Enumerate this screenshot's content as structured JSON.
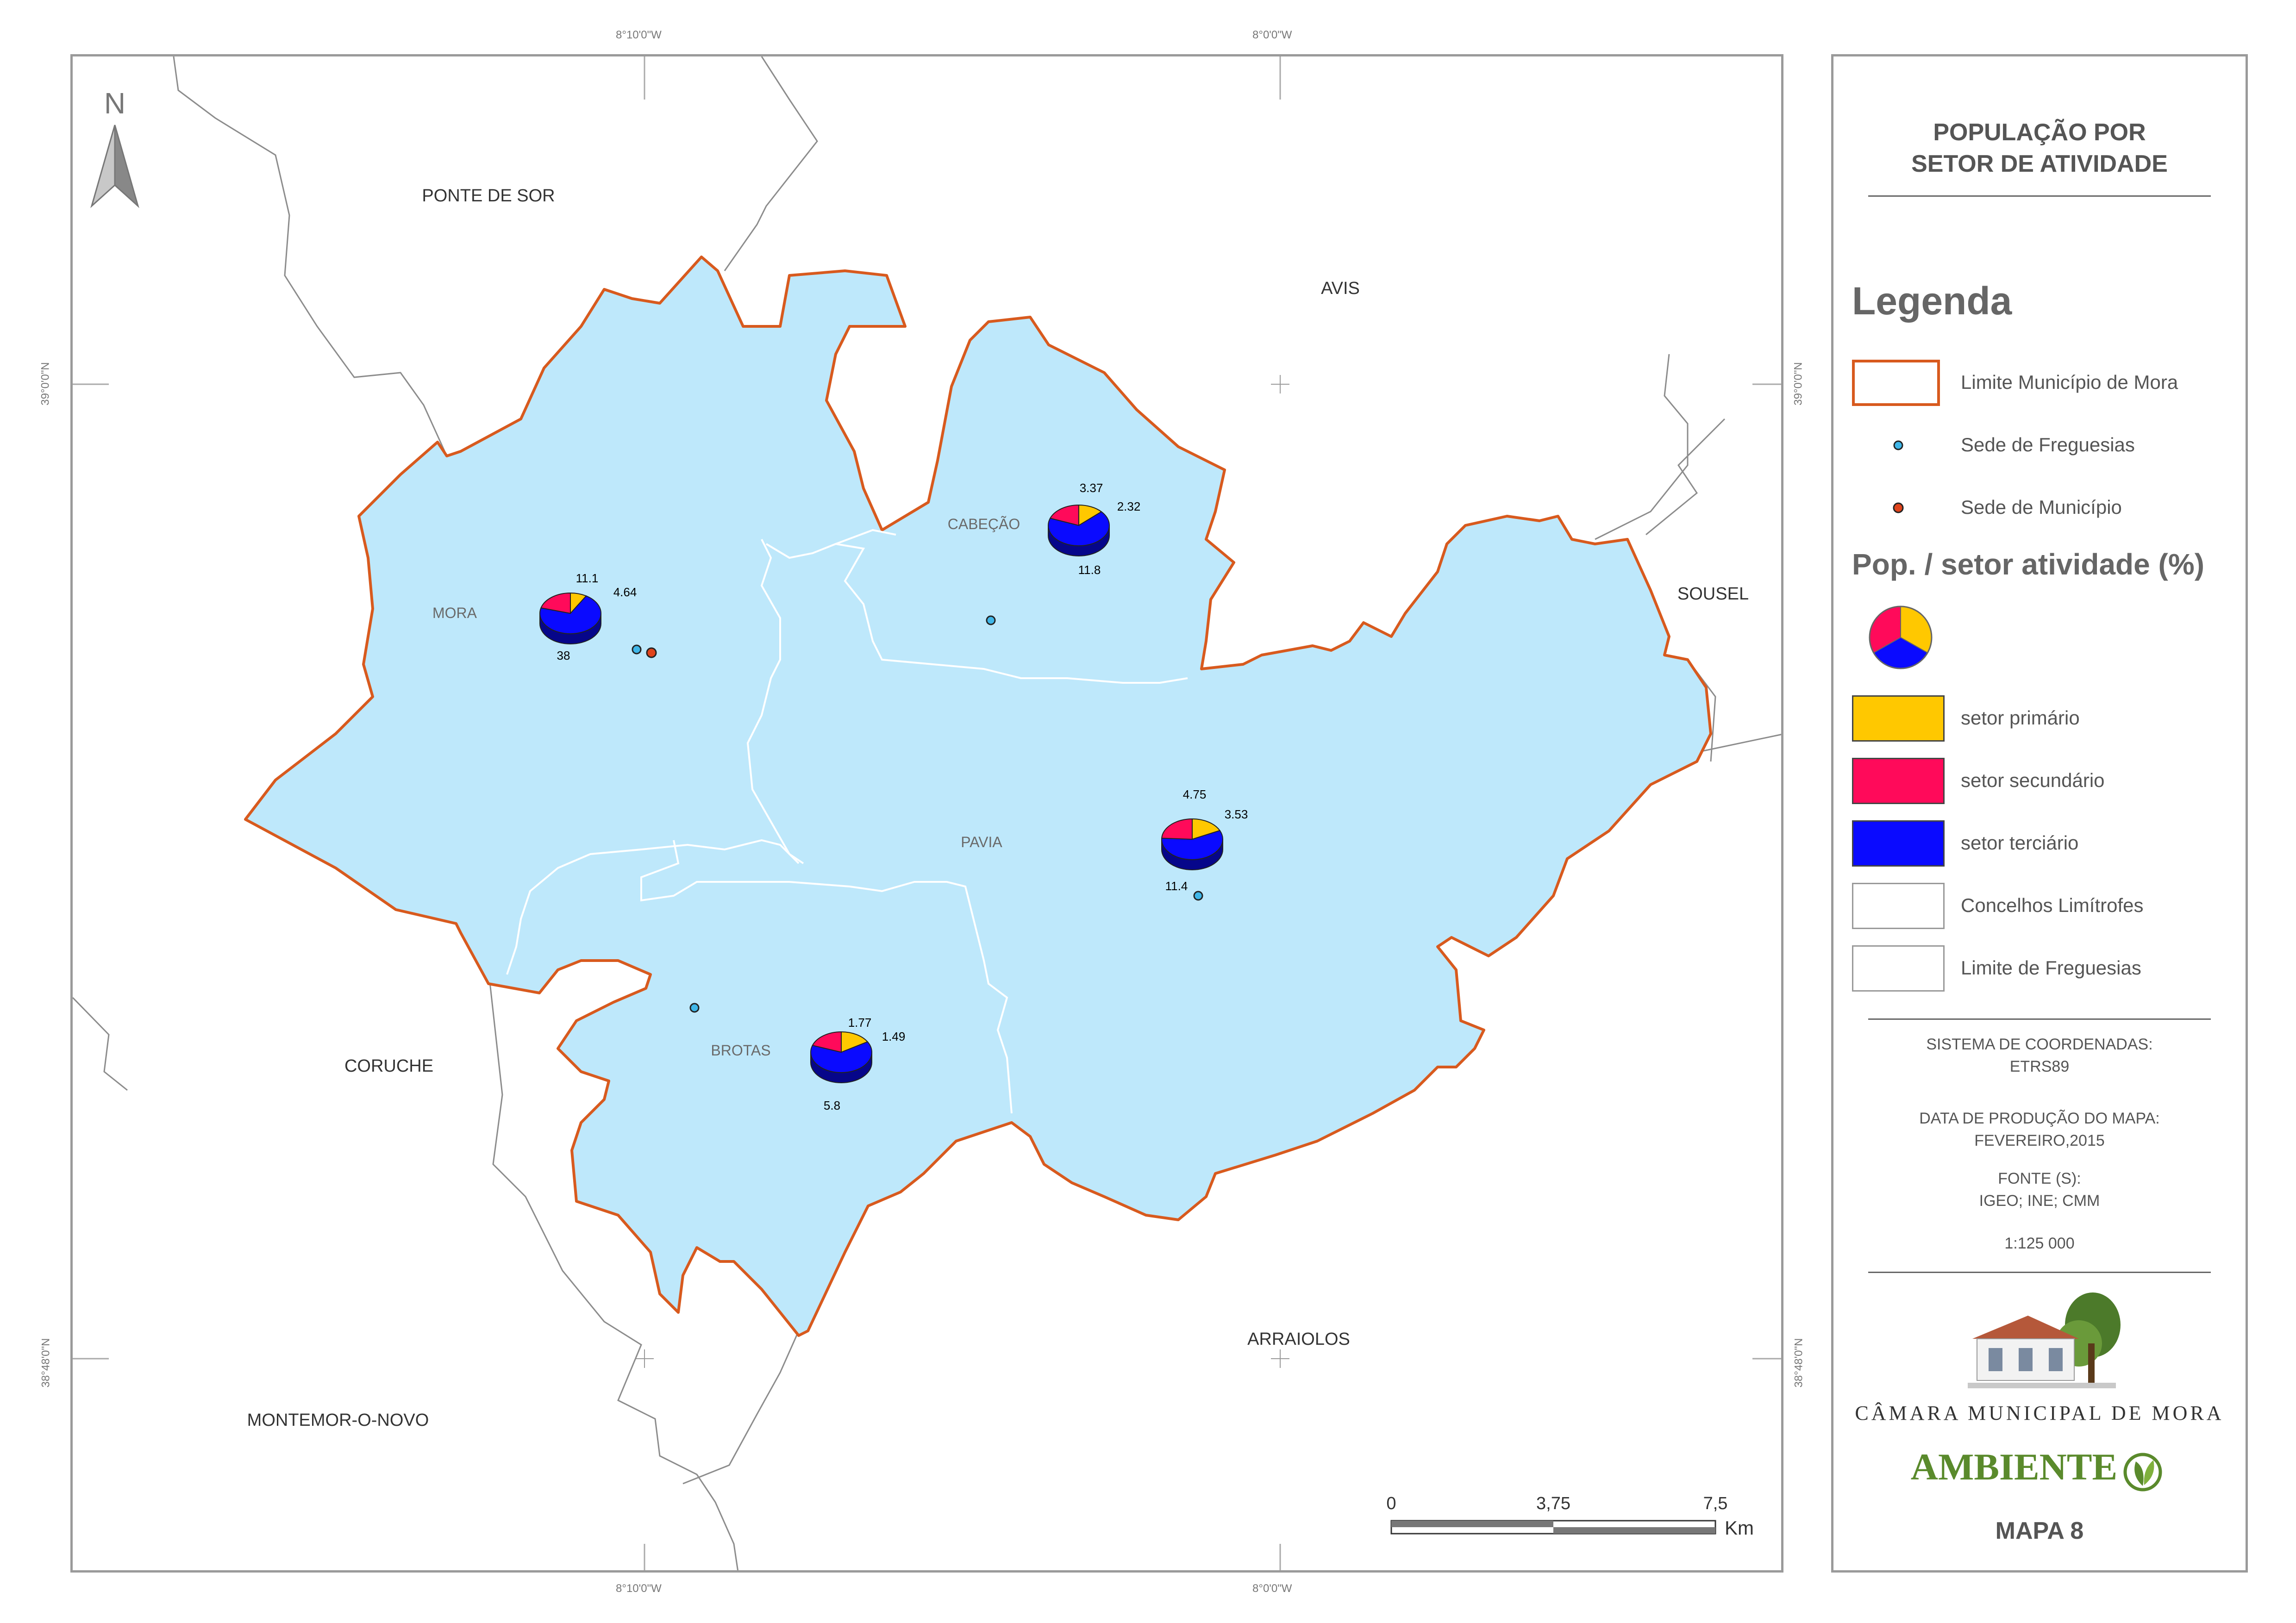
{
  "graticule": {
    "top": [
      "8°10'0\"W",
      "8°0'0\"W"
    ],
    "bottom": [
      "8°10'0\"W",
      "8°0'0\"W"
    ],
    "left": [
      "39°0'0\"N",
      "38°48'0\"N"
    ],
    "right": [
      "39°0'0\"N",
      "38°48'0\"N"
    ]
  },
  "north_arrow": {
    "label": "N"
  },
  "neighbors": [
    "PONTE DE SOR",
    "AVIS",
    "SOUSEL",
    "CORUCHE",
    "ARRAIOLOS",
    "MONTEMOR-O-NOVO"
  ],
  "parishes": [
    "MORA",
    "CABEÇÃO",
    "PAVIA",
    "BROTAS"
  ],
  "pie_charts": [
    {
      "parish": "MORA",
      "primario": 4.64,
      "secundario": 11.1,
      "terciario": 38
    },
    {
      "parish": "CABEÇÃO",
      "primario": 2.32,
      "secundario": 3.37,
      "terciario": 11.8
    },
    {
      "parish": "PAVIA",
      "primario": 3.53,
      "secundario": 4.75,
      "terciario": 11.4
    },
    {
      "parish": "BROTAS",
      "primario": 1.49,
      "secundario": 1.77,
      "terciario": 5.8
    }
  ],
  "scale_bar": {
    "ticks": [
      "0",
      "3,75",
      "7,5"
    ],
    "unit": "Km"
  },
  "colors": {
    "municipality_fill": "#bee8fb",
    "municipality_border": "#d85a1e",
    "parish_border": "#ffffff",
    "neighbor_border": "#8c8c8c",
    "primario": "#ffc800",
    "secundario": "#ff0a5a",
    "terciario": "#0a0aff",
    "sede_freguesia": "#3fb6e8",
    "sede_municipio": "#e0441c"
  },
  "legend_panel": {
    "title_line1": "POPULAÇÃO POR",
    "title_line2": "SETOR DE ATIVIDADE",
    "legend_heading": "Legenda",
    "items": {
      "limite_municipio": "Limite Município de Mora",
      "sede_freguesias": "Sede de Freguesias",
      "sede_municipio": "Sede de Município",
      "pop_heading": "Pop. / setor atividade (%)",
      "setor_primario": "setor primário",
      "setor_secundario": "setor secundário",
      "setor_terciario": "setor terciário",
      "concelhos_limitrofes": "Concelhos Limítrofes",
      "limite_freguesias": "Limite de Freguesias"
    },
    "info": {
      "coord_label": "SISTEMA DE COORDENADAS:",
      "coord_value": "ETRS89",
      "date_label": "DATA DE PRODUÇÃO DO MAPA:",
      "date_value": "FEVEREIRO,2015",
      "source_label": "FONTE (S):",
      "source_value": "IGEO; INE; CMM",
      "scale": "1:125 000"
    },
    "logo_text": "CÂMARA MUNICIPAL DE MORA",
    "ambiente": "AMBIENTE",
    "map_number": "MAPA 8"
  }
}
